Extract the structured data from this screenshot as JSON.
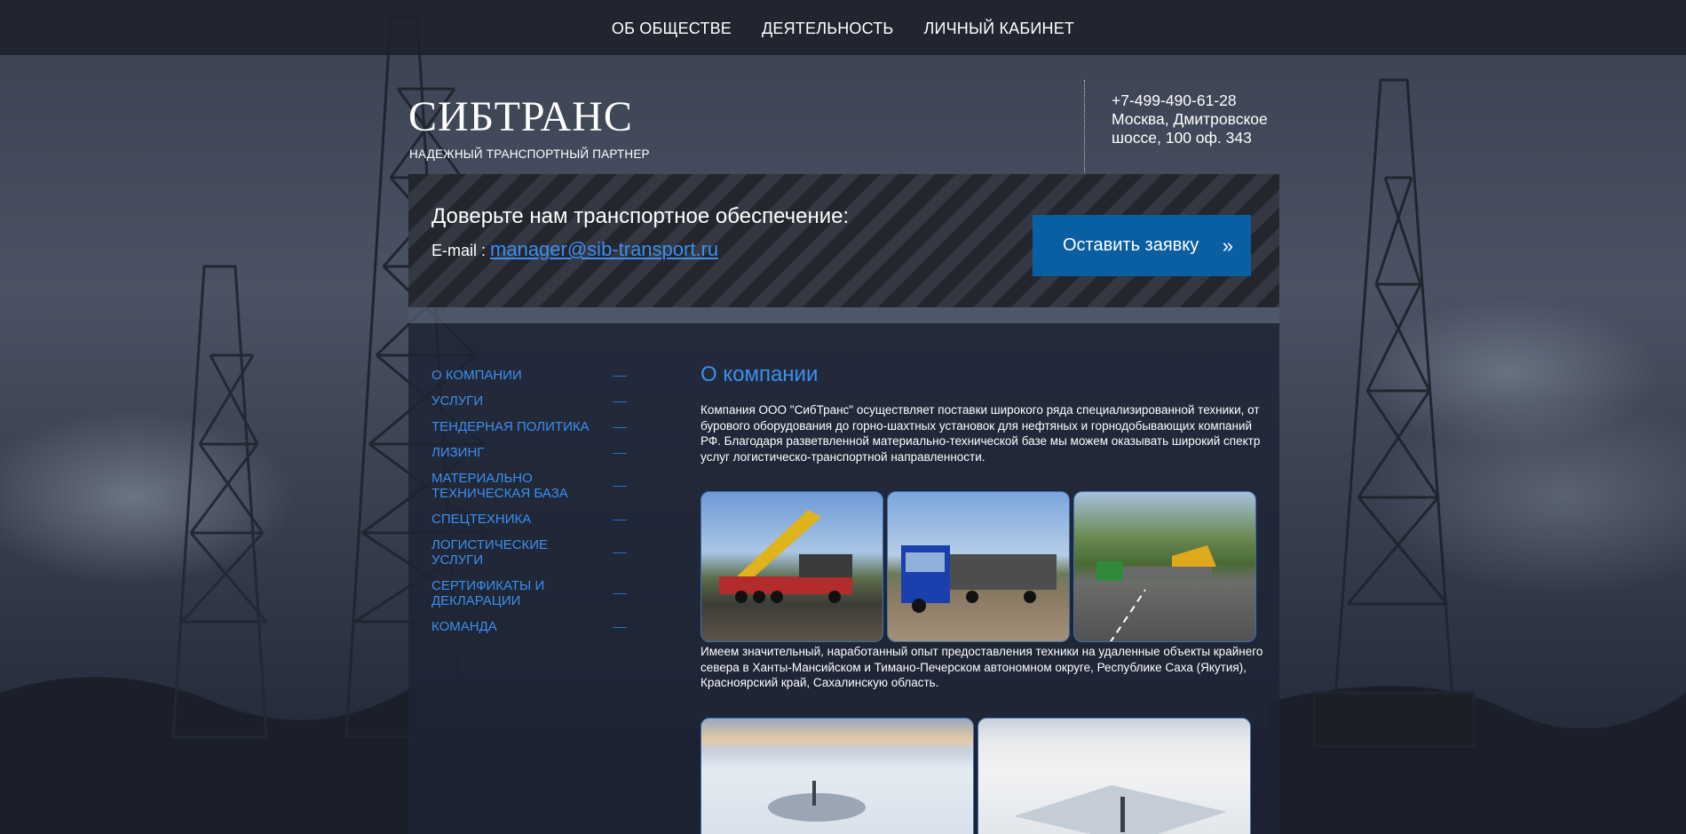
{
  "nav": {
    "items": [
      "ОБ ОБЩЕСТВЕ",
      "ДЕЯТЕЛЬНОСТЬ",
      "ЛИЧНЫЙ КАБИНЕТ"
    ]
  },
  "header": {
    "brand": "СИБТРАНС",
    "tagline": "НАДЕЖНЫЙ ТРАНСПОРТНЫЙ ПАРТНЕР",
    "phone": "+7-499-490-61-28",
    "address_line1": "Москва, Дмитровское",
    "address_line2": "шоссе, 100 оф. 343"
  },
  "banner": {
    "headline": "Доверьте нам транспортное обеспечение:",
    "email_label": "E-mail : ",
    "email": "manager@sib-transport.ru",
    "cta_label": "Оставить заявку",
    "cta_arrows": "»"
  },
  "sidebar": {
    "items": [
      [
        "О КОМПАНИИ"
      ],
      [
        "УСЛУГИ"
      ],
      [
        "ТЕНДЕРНАЯ ПОЛИТИКА"
      ],
      [
        "ЛИЗИНГ"
      ],
      [
        "МАТЕРИАЛЬНО",
        "ТЕХНИЧЕСКАЯ БАЗА"
      ],
      [
        "СПЕЦТЕХНИКА"
      ],
      [
        "ЛОГИСТИЧЕСКИЕ",
        "УСЛУГИ"
      ],
      [
        "СЕРТИФИКАТЫ И",
        "ДЕКЛАРАЦИИ"
      ],
      [
        "КОМАНДА"
      ]
    ]
  },
  "main": {
    "title": "О компании",
    "intro": "Компания ООО \"СибТранс\" осуществляет поставки широкого ряда специализированной техники, от бурового оборудования до горно-шахтных установок для нефтяных и горнодобывающих компаний РФ. Благодаря разветвленной материально-технической базе мы можем оказывать широкий спектр услуг логистическо-транспортной направленности.",
    "experience": "Имеем значительный, наработанный опыт предоставления техники на удаленные объекты крайнего севера в Ханты-Мансийском и Тимано-Печерском автономном округе, Республике Саха (Якутия), Красноярский край, Сахалинскую область."
  },
  "colors": {
    "accent": "#3d8ff0",
    "button": "#0a5fa3",
    "nav_bg": "#1c212b"
  }
}
